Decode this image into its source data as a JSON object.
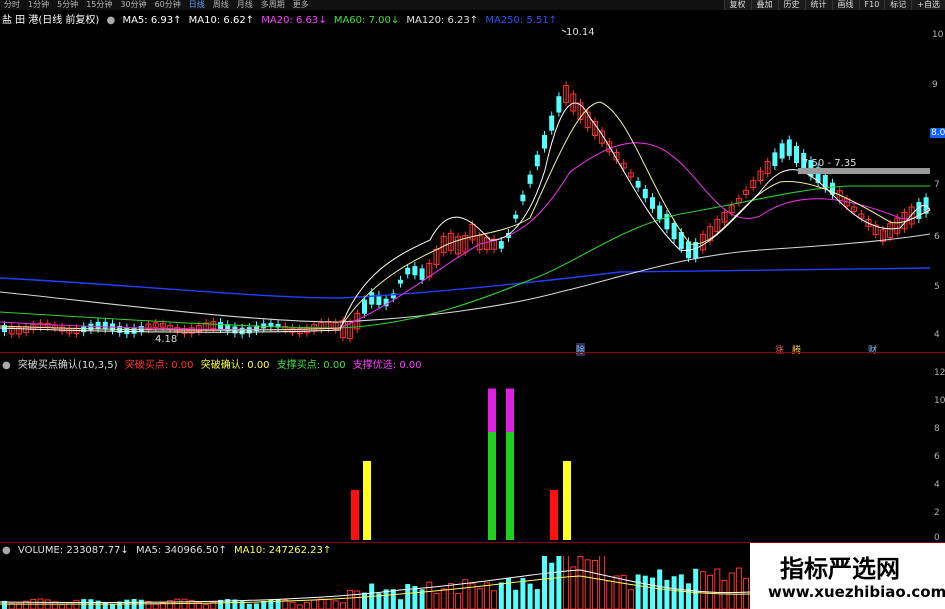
{
  "toolbar": {
    "periods": [
      "分时",
      "1分钟",
      "5分钟",
      "15分钟",
      "30分钟",
      "60分钟",
      "日线",
      "周线",
      "月线",
      "多周期",
      "更多"
    ],
    "active_period": "日线",
    "right_buttons": [
      "复权",
      "叠加",
      "历史",
      "统计",
      "画线",
      "F10",
      "标记",
      "+自选"
    ]
  },
  "main_panel": {
    "stock_title": "盐 田 港(日线 前复权)",
    "ma_legend": [
      {
        "label": "MA5: 6.93↑",
        "color": "#ffffff"
      },
      {
        "label": "MA10: 6.62↑",
        "color": "#ffffff"
      },
      {
        "label": "MA20: 6.63↓",
        "color": "#ff40ff"
      },
      {
        "label": "MA60: 7.00↓",
        "color": "#40e040"
      },
      {
        "label": "MA120: 6.23↑",
        "color": "#e0e0e0"
      },
      {
        "label": "MA250: 5.51↑",
        "color": "#3050ff"
      }
    ],
    "high_label": "10.14",
    "low_label": "4.18",
    "range_label": "7.50 - 7.35",
    "event_marks": [
      "除",
      "涨",
      "腾",
      "财"
    ],
    "right_axis": [
      "10",
      "9",
      "8.0",
      "7",
      "6",
      "5",
      "4"
    ]
  },
  "indicator_panel": {
    "title": "突破买点确认(10,3,5)",
    "legend": [
      {
        "label": "突破买点: 0.00",
        "color": "#ff3030"
      },
      {
        "label": "突破确认: 0.00",
        "color": "#ffff40"
      },
      {
        "label": "支撑买点: 0.00",
        "color": "#40e040"
      },
      {
        "label": "支撑优选: 0.00",
        "color": "#ff40ff"
      }
    ],
    "right_axis": [
      "12",
      "10",
      "8",
      "6",
      "4",
      "2",
      "0"
    ],
    "signals": [
      {
        "index": 0,
        "type": "突破买点",
        "value": 4,
        "color": "#ff1010"
      },
      {
        "index": 1,
        "type": "突破确认",
        "value": 6,
        "color": "#ffff20"
      },
      {
        "index": 2,
        "type": "支撑买点",
        "value": 8,
        "color": "#20d020"
      },
      {
        "index": 2,
        "type": "支撑优选",
        "value": 11,
        "color": "#e020e0"
      },
      {
        "index": 3,
        "type": "支撑买点",
        "value": 8,
        "color": "#20d020"
      },
      {
        "index": 3,
        "type": "支撑优选",
        "value": 11,
        "color": "#e020e0"
      },
      {
        "index": 4,
        "type": "突破买点",
        "value": 4,
        "color": "#ff1010"
      },
      {
        "index": 5,
        "type": "突破确认",
        "value": 6,
        "color": "#ffff20"
      }
    ]
  },
  "volume_panel": {
    "legend": [
      {
        "label": "VOLUME: 233087.77↓",
        "color": "#e0e0e0"
      },
      {
        "label": "MA5: 340966.50↑",
        "color": "#e0e0e0"
      },
      {
        "label": "MA10: 247262.23↑",
        "color": "#ffff60"
      }
    ]
  },
  "watermark": {
    "title": "指标严选网",
    "url": "www.xuezhibiao.com"
  }
}
